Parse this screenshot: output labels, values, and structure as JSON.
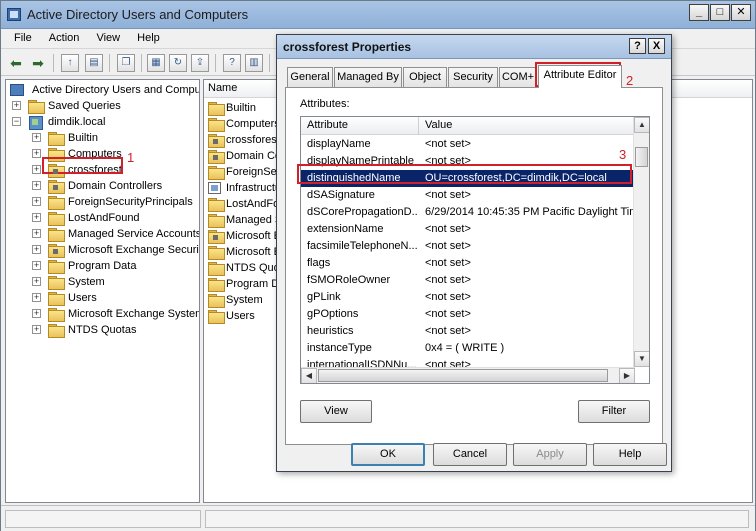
{
  "window": {
    "title": "Active Directory Users and Computers"
  },
  "menu": [
    "File",
    "Action",
    "View",
    "Help"
  ],
  "tree": {
    "root": "Active Directory Users and Comput",
    "saved_queries": "Saved Queries",
    "domain": "dimdik.local",
    "children": [
      "Builtin",
      "Computers",
      "crossforest",
      "Domain Controllers",
      "ForeignSecurityPrincipals",
      "LostAndFound",
      "Managed Service Accounts",
      "Microsoft Exchange Securit",
      "Program Data",
      "System",
      "Users",
      "Microsoft Exchange System",
      "NTDS Quotas"
    ]
  },
  "list": {
    "header": "Name",
    "items": [
      "Builtin",
      "Computers",
      "crossforest",
      "Domain Con",
      "ForeignSec",
      "Infrastructu",
      "LostAndFou",
      "Managed S",
      "Microsoft E",
      "Microsoft E",
      "NTDS Quot",
      "Program Da",
      "System",
      "Users"
    ]
  },
  "dialog": {
    "title": "crossforest Properties",
    "help_btn": "?",
    "close_btn": "X",
    "tabs": [
      "General",
      "Managed By",
      "Object",
      "Security",
      "COM+",
      "Attribute Editor"
    ],
    "attributes_label": "Attributes:",
    "col_attribute": "Attribute",
    "col_value": "Value",
    "rows": [
      {
        "attr": "displayName",
        "value": "<not set>"
      },
      {
        "attr": "displayNamePrintable",
        "value": "<not set>"
      },
      {
        "attr": "distinguishedName",
        "value": "OU=crossforest,DC=dimdik,DC=local"
      },
      {
        "attr": "dSASignature",
        "value": "<not set>"
      },
      {
        "attr": "dSCorePropagationD...",
        "value": "6/29/2014 10:45:35 PM Pacific Daylight Tim"
      },
      {
        "attr": "extensionName",
        "value": "<not set>"
      },
      {
        "attr": "facsimileTelephoneN...",
        "value": "<not set>"
      },
      {
        "attr": "flags",
        "value": "<not set>"
      },
      {
        "attr": "fSMORoleOwner",
        "value": "<not set>"
      },
      {
        "attr": "gPLink",
        "value": "<not set>"
      },
      {
        "attr": "gPOptions",
        "value": "<not set>"
      },
      {
        "attr": "heuristics",
        "value": "<not set>"
      },
      {
        "attr": "instanceType",
        "value": "0x4 = ( WRITE )"
      },
      {
        "attr": "internationalISDNNu...",
        "value": "<not set>"
      }
    ],
    "view_btn": "View",
    "filter_btn": "Filter",
    "ok_btn": "OK",
    "cancel_btn": "Cancel",
    "apply_btn": "Apply",
    "help2_btn": "Help"
  },
  "annotations": {
    "one": "1",
    "two": "2",
    "three": "3"
  },
  "colors": {
    "highlight_red": "#d0202a",
    "selection": "#0a246a"
  }
}
